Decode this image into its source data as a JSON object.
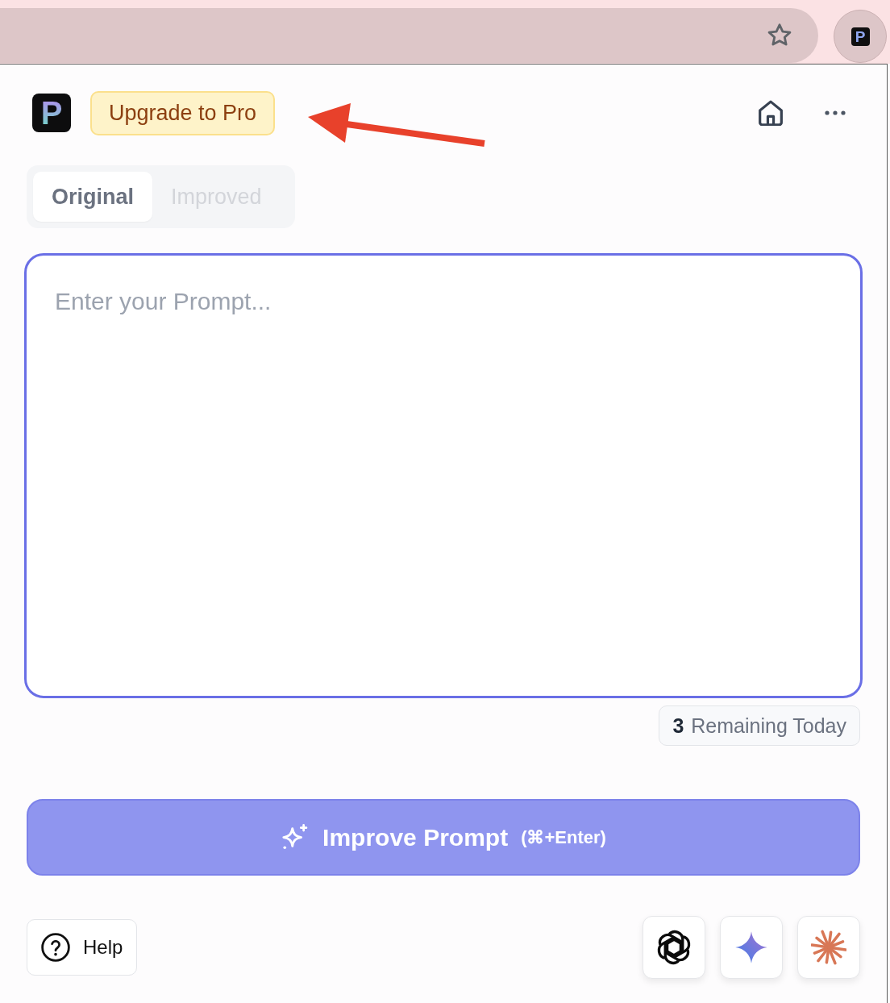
{
  "browser": {
    "extension_logo": "P"
  },
  "header": {
    "logo": "P",
    "upgrade_button": "Upgrade to Pro"
  },
  "tabs": [
    {
      "label": "Original",
      "selected": true
    },
    {
      "label": "Improved",
      "selected": false
    }
  ],
  "prompt": {
    "placeholder": "Enter your Prompt..."
  },
  "usage": {
    "count": "3",
    "label": "Remaining Today"
  },
  "improve_button": {
    "label": "Improve Prompt",
    "shortcut": "(⌘+Enter)"
  },
  "help_button": {
    "label": "Help"
  },
  "model_buttons": [
    {
      "kind": "knot"
    },
    {
      "kind": "star"
    },
    {
      "kind": "asterisk"
    }
  ]
}
